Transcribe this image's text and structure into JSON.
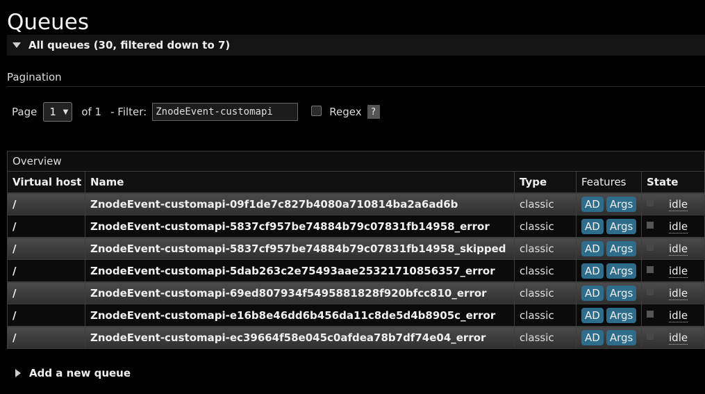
{
  "page": {
    "title": "Queues"
  },
  "all_queues": {
    "label": "All queues (30, filtered down to 7)"
  },
  "pagination": {
    "label": "Pagination",
    "page_label": "Page",
    "page_value": "1",
    "of_label": "of 1",
    "filter_label": "- Filter:",
    "filter_value": "ZnodeEvent-customapi",
    "regex_label": "Regex",
    "help_label": "?"
  },
  "table": {
    "overview_label": "Overview",
    "columns": {
      "vhost": "Virtual host",
      "name": "Name",
      "type": "Type",
      "features": "Features",
      "state": "State"
    },
    "rows": [
      {
        "vhost": "/",
        "name": "ZnodeEvent-customapi-09f1de7c827b4080a710814ba2a6ad6b",
        "type": "classic",
        "features": [
          "AD",
          "Args"
        ],
        "state": "idle"
      },
      {
        "vhost": "/",
        "name": "ZnodeEvent-customapi-5837cf957be74884b79c07831fb14958_error",
        "type": "classic",
        "features": [
          "AD",
          "Args"
        ],
        "state": "idle"
      },
      {
        "vhost": "/",
        "name": "ZnodeEvent-customapi-5837cf957be74884b79c07831fb14958_skipped",
        "type": "classic",
        "features": [
          "AD",
          "Args"
        ],
        "state": "idle"
      },
      {
        "vhost": "/",
        "name": "ZnodeEvent-customapi-5dab263c2e75493aae25321710856357_error",
        "type": "classic",
        "features": [
          "AD",
          "Args"
        ],
        "state": "idle"
      },
      {
        "vhost": "/",
        "name": "ZnodeEvent-customapi-69ed807934f5495881828f920bfcc810_error",
        "type": "classic",
        "features": [
          "AD",
          "Args"
        ],
        "state": "idle"
      },
      {
        "vhost": "/",
        "name": "ZnodeEvent-customapi-e16b8e46dd6b456da11c8de5d4b8905c_error",
        "type": "classic",
        "features": [
          "AD",
          "Args"
        ],
        "state": "idle"
      },
      {
        "vhost": "/",
        "name": "ZnodeEvent-customapi-ec39664f58e045c0afdea78b7df74e04_error",
        "type": "classic",
        "features": [
          "AD",
          "Args"
        ],
        "state": "idle"
      }
    ]
  },
  "add_queue": {
    "label": "Add a new queue"
  },
  "colors": {
    "accent": "#2d6c8a",
    "background": "#000000"
  }
}
